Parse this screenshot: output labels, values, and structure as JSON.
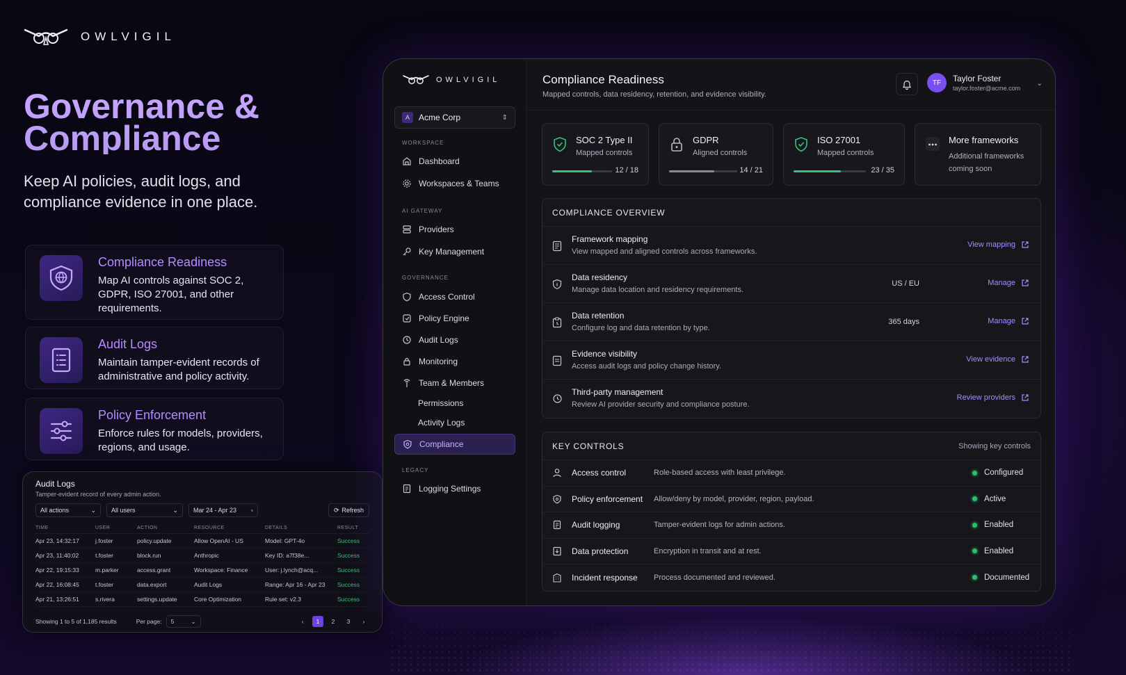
{
  "brand": {
    "name": "OWLVIGIL"
  },
  "hero": {
    "title": "Governance & Compliance",
    "subtitle": "Keep AI policies, audit logs, and compliance evidence in one place."
  },
  "features": [
    {
      "title": "Compliance Readiness",
      "desc": "Map AI controls against SOC 2, GDPR, ISO 27001, and other requirements.",
      "icon": "shield-globe-icon"
    },
    {
      "title": "Audit Logs",
      "desc": "Maintain tamper-evident records of administrative and policy activity.",
      "icon": "document-list-icon"
    },
    {
      "title": "Policy Enforcement",
      "desc": "Enforce rules for models, providers, regions, and usage.",
      "icon": "sliders-icon"
    }
  ],
  "audit": {
    "title": "Audit Logs",
    "subtitle": "Tamper-evident record of every admin action.",
    "filters": {
      "actions": "All actions",
      "users": "All users",
      "dates": "Mar 24 - Apr 23"
    },
    "refresh": "Refresh",
    "columns": [
      "TIME",
      "USER",
      "ACTION",
      "RESOURCE",
      "DETAILS",
      "RESULT"
    ],
    "rows": [
      [
        "Apr 23, 14:32:17",
        "j.foster",
        "policy.update",
        "Allow OpenAI - US",
        "Model: GPT-4o",
        "Success"
      ],
      [
        "Apr 23, 11:40:02",
        "t.foster",
        "block.run",
        "Anthropic",
        "Key ID: a7f38e...",
        "Success"
      ],
      [
        "Apr 22, 19:15:33",
        "m.parker",
        "access.grant",
        "Workspace: Finance",
        "User: j.lynch@acq...",
        "Success"
      ],
      [
        "Apr 22, 16:08:45",
        "t.foster",
        "data.export",
        "Audit Logs",
        "Range: Apr 16 - Apr 23",
        "Success"
      ],
      [
        "Apr 21, 13:26:51",
        "s.rivera",
        "settings.update",
        "Core Optimization",
        "Rule set: v2.3",
        "Success"
      ]
    ],
    "showing": "Showing 1 to 5 of 1,185 results",
    "per_page_label": "Per page:",
    "per_page": "5",
    "pages": [
      "1",
      "2",
      "3"
    ]
  },
  "sidebar": {
    "brand": "OWLVIGIL",
    "org": {
      "initial": "A",
      "name": "Acme Corp"
    },
    "sections": {
      "workspace": "WORKSPACE",
      "gateway": "AI GATEWAY",
      "governance": "GOVERNANCE",
      "legacy": "LEGACY"
    },
    "items": {
      "dashboard": "Dashboard",
      "workspaces": "Workspaces & Teams",
      "providers": "Providers",
      "keys": "Key Management",
      "access": "Access Control",
      "policy": "Policy Engine",
      "audit": "Audit Logs",
      "monitoring": "Monitoring",
      "team": "Team & Members",
      "permissions": "Permissions",
      "activity": "Activity Logs",
      "compliance": "Compliance",
      "logging": "Logging Settings"
    }
  },
  "header": {
    "title": "Compliance Readiness",
    "subtitle": "Mapped controls, data residency, retention, and evidence visibility.",
    "user": {
      "initials": "TF",
      "name": "Taylor Foster",
      "email": "taylor.foster@acme.com"
    }
  },
  "frameworks": [
    {
      "name": "SOC 2 Type II",
      "sub": "Mapped controls",
      "value": "12 / 18",
      "progress": 0.667,
      "icon": "shield-check-icon"
    },
    {
      "name": "GDPR",
      "sub": "Aligned controls",
      "value": "14 / 21",
      "progress": 0.667,
      "icon": "lock-icon"
    },
    {
      "name": "ISO 27001",
      "sub": "Mapped controls",
      "value": "23 / 35",
      "progress": 0.657,
      "icon": "shield-check-icon"
    },
    {
      "name": "More frameworks",
      "sub": "Additional frameworks coming soon",
      "icon": "more-icon"
    }
  ],
  "overview": {
    "title": "COMPLIANCE OVERVIEW",
    "rows": [
      {
        "name": "Framework mapping",
        "desc": "View mapped and aligned controls across frameworks.",
        "value": "",
        "link": "View mapping"
      },
      {
        "name": "Data residency",
        "desc": "Manage data location and residency requirements.",
        "value": "US / EU",
        "link": "Manage"
      },
      {
        "name": "Data retention",
        "desc": "Configure log and data retention by type.",
        "value": "365 days",
        "link": "Manage"
      },
      {
        "name": "Evidence visibility",
        "desc": "Access audit logs and policy change history.",
        "value": "",
        "link": "View evidence"
      },
      {
        "name": "Third-party management",
        "desc": "Review AI provider security and compliance posture.",
        "value": "",
        "link": "Review providers"
      }
    ]
  },
  "controls": {
    "title": "KEY CONTROLS",
    "note": "Showing key controls",
    "rows": [
      {
        "name": "Access control",
        "desc": "Role-based access with least privilege.",
        "status": "Configured"
      },
      {
        "name": "Policy enforcement",
        "desc": "Allow/deny by model, provider, region, payload.",
        "status": "Active"
      },
      {
        "name": "Audit logging",
        "desc": "Tamper-evident logs for admin actions.",
        "status": "Enabled"
      },
      {
        "name": "Data protection",
        "desc": "Encryption in transit and at rest.",
        "status": "Enabled"
      },
      {
        "name": "Incident response",
        "desc": "Process documented and reviewed.",
        "status": "Documented"
      }
    ]
  },
  "colors": {
    "accent": "#a98bff",
    "success": "#2fbd6f",
    "active_nav": "#2a2150"
  }
}
